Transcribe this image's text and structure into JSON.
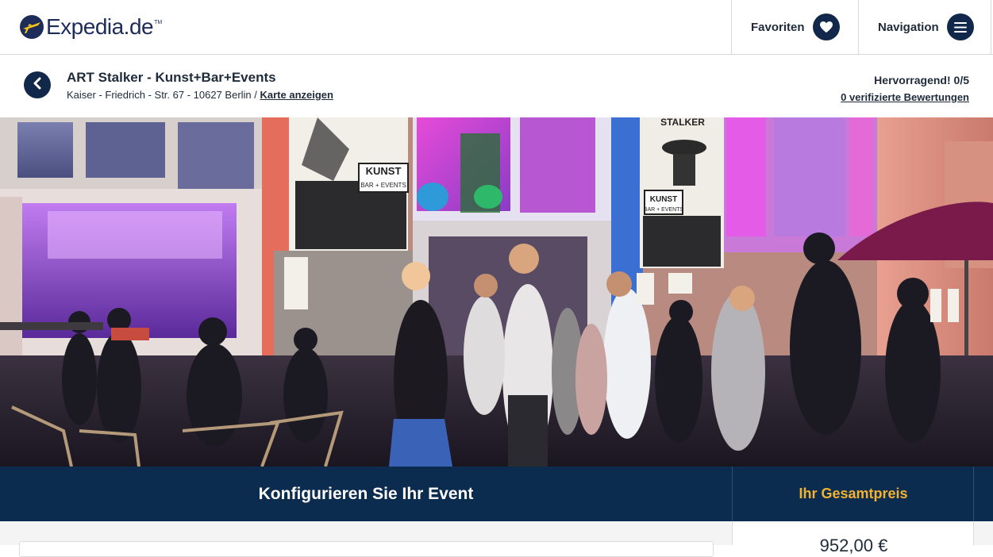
{
  "header": {
    "logo_text": "Expedia.de",
    "logo_tm": "TM",
    "favorites_label": "Favoriten",
    "favorites_icon": "heart-icon",
    "navigation_label": "Navigation",
    "navigation_icon": "menu-icon"
  },
  "venue": {
    "title": "ART Stalker - Kunst+Bar+Events",
    "address": "Kaiser - Friedrich - Str. 67 - 10627 Berlin / ",
    "map_link": "Karte anzeigen",
    "rating_label": "Hervorragend! 0/5",
    "reviews_link": "0 verifizierte Bewertungen",
    "back_icon": "chevron-left-icon"
  },
  "photo": {
    "sign_left": "KUNST",
    "sign_left_sub": "BAR + EVENTS",
    "sign_right_top": "STALKER",
    "sign_right": "KUNST",
    "sign_right_sub": "BAR + EVENTS"
  },
  "booking": {
    "configure_title": "Konfigurieren Sie Ihr Event",
    "total_label": "Ihr Gesamtpreis",
    "total_price": "952,00 €"
  },
  "colors": {
    "navy": "#0b2b4f",
    "brand_dark": "#12284a",
    "accent_yellow": "#f2b230"
  }
}
